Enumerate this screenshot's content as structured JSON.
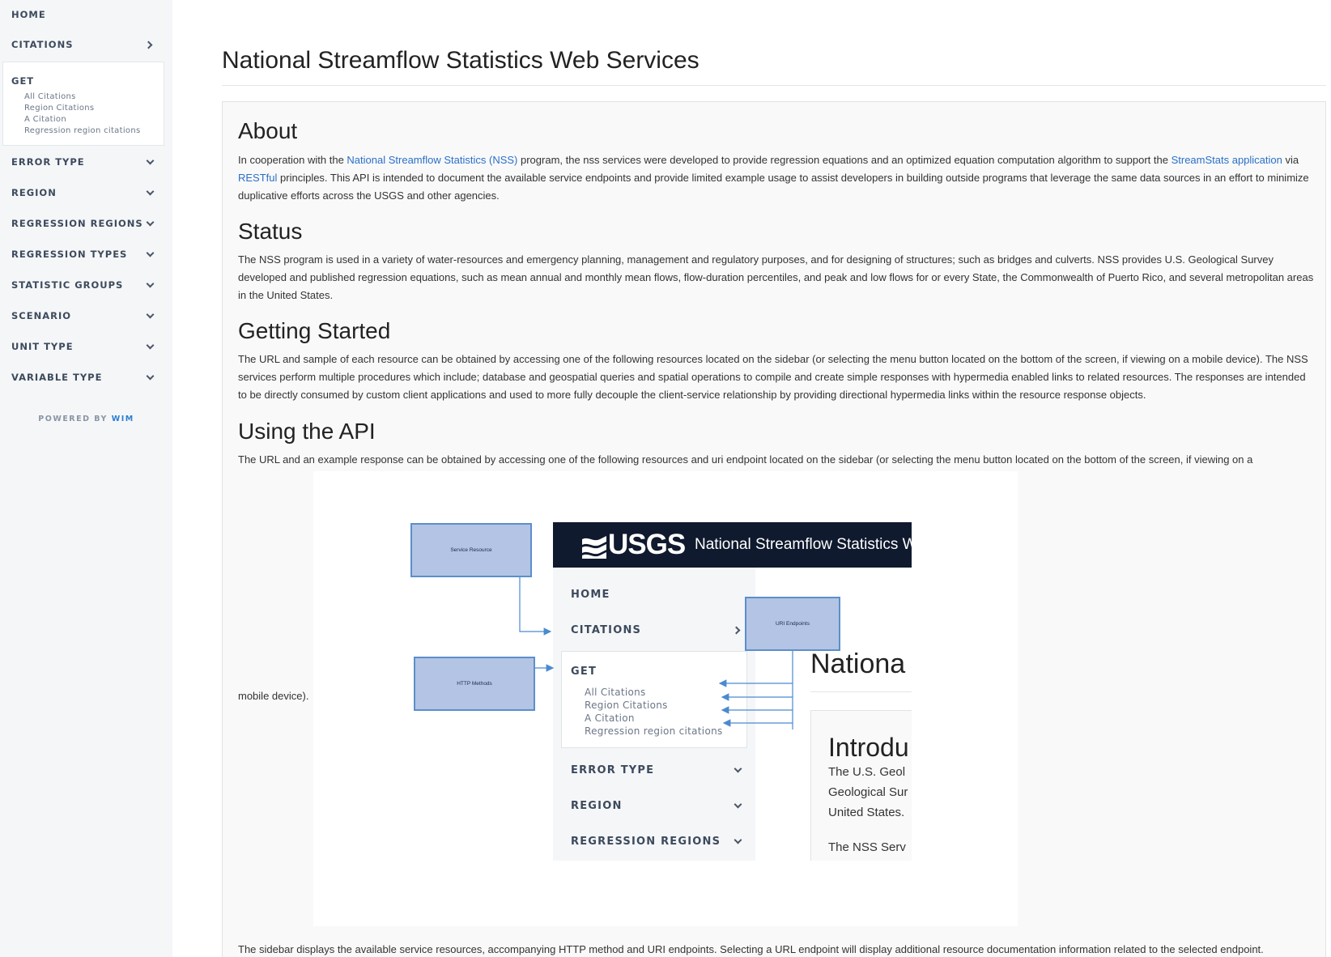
{
  "sidebar": {
    "items": [
      {
        "label": "HOME"
      },
      {
        "label": "CITATIONS"
      },
      {
        "label": "ERROR TYPE"
      },
      {
        "label": "REGION"
      },
      {
        "label": "REGRESSION REGIONS"
      },
      {
        "label": "REGRESSION TYPES"
      },
      {
        "label": "STATISTIC GROUPS"
      },
      {
        "label": "SCENARIO"
      },
      {
        "label": "UNIT TYPE"
      },
      {
        "label": "VARIABLE TYPE"
      }
    ],
    "get": {
      "title": "GET",
      "links": [
        "All Citations",
        "Region Citations",
        "A Citation",
        "Regression region citations"
      ]
    },
    "powered_prefix": "POWERED BY",
    "powered_brand": "WIM"
  },
  "main": {
    "title": "National Streamflow Statistics Web Services",
    "about": {
      "heading": "About",
      "t1": "In cooperation with the ",
      "link1": "National Streamflow Statistics (NSS)",
      "t2": " program, the nss services were developed to provide regression equations and an optimized equation computation algorithm to support the ",
      "link2": "StreamStats application",
      "t3": " via ",
      "link3": "RESTful",
      "t4": " principles. This API is intended to document the available service endpoints and provide limited example usage to assist developers in building outside programs that leverage the same data sources in an effort to minimize duplicative efforts across the USGS and other agencies."
    },
    "status": {
      "heading": "Status",
      "text": "The NSS program is used in a variety of water-resources and emergency planning, management and regulatory purposes, and for designing of structures; such as bridges and culverts. NSS provides U.S. Geological Survey developed and published regression equations, such as mean annual and monthly mean flows, flow-duration percentiles, and peak and low flows for or every State, the Commonwealth of Puerto Rico, and several metropolitan areas in the United States."
    },
    "getting_started": {
      "heading": "Getting Started",
      "text": "The URL and sample of each resource can be obtained by accessing one of the following resources located on the sidebar (or selecting the menu button located on the bottom of the screen, if viewing on a mobile device). The NSS services perform multiple procedures which include; database and geospatial queries and spatial operations to compile and create simple responses with hypermedia enabled links to related resources. The responses are intended to be directly consumed by custom client applications and used to more fully decouple the client-service relationship by providing directional hypermedia links within the resource response objects."
    },
    "using_api": {
      "heading": "Using the API",
      "text": "The URL and an example response can be obtained by accessing one of the following resources and uri endpoint located on the sidebar (or selecting the menu button located on the bottom of the screen, if viewing on a",
      "text_cont": "mobile device).",
      "footer_text": "The sidebar displays the available service resources, accompanying HTTP method and URI endpoints. Selecting a URL endpoint will display additional resource documentation information related to the selected endpoint."
    }
  },
  "diagram": {
    "service_resource": "Service Resource",
    "http_methods": "HTTP Methods",
    "uri_endpoints": "URI Endpoints",
    "logo_text": "USGS",
    "app_title": "National Streamflow Statistics We",
    "nav": [
      "HOME",
      "CITATIONS",
      "GET",
      "ERROR TYPE",
      "REGION",
      "REGRESSION REGIONS"
    ],
    "get_links": [
      "All Citations",
      "Region Citations",
      "A Citation",
      "Regression region citations"
    ],
    "main_heading": "Nationa",
    "intro_heading": "Introdu",
    "intro_lines": [
      "The U.S. Geol",
      "Geological Sur",
      "United States.",
      "The NSS Serv"
    ],
    "colors": {
      "box_fill": "#b4c4e4",
      "box_border": "#5b8fcc",
      "arrow": "#4a8ad0"
    }
  }
}
